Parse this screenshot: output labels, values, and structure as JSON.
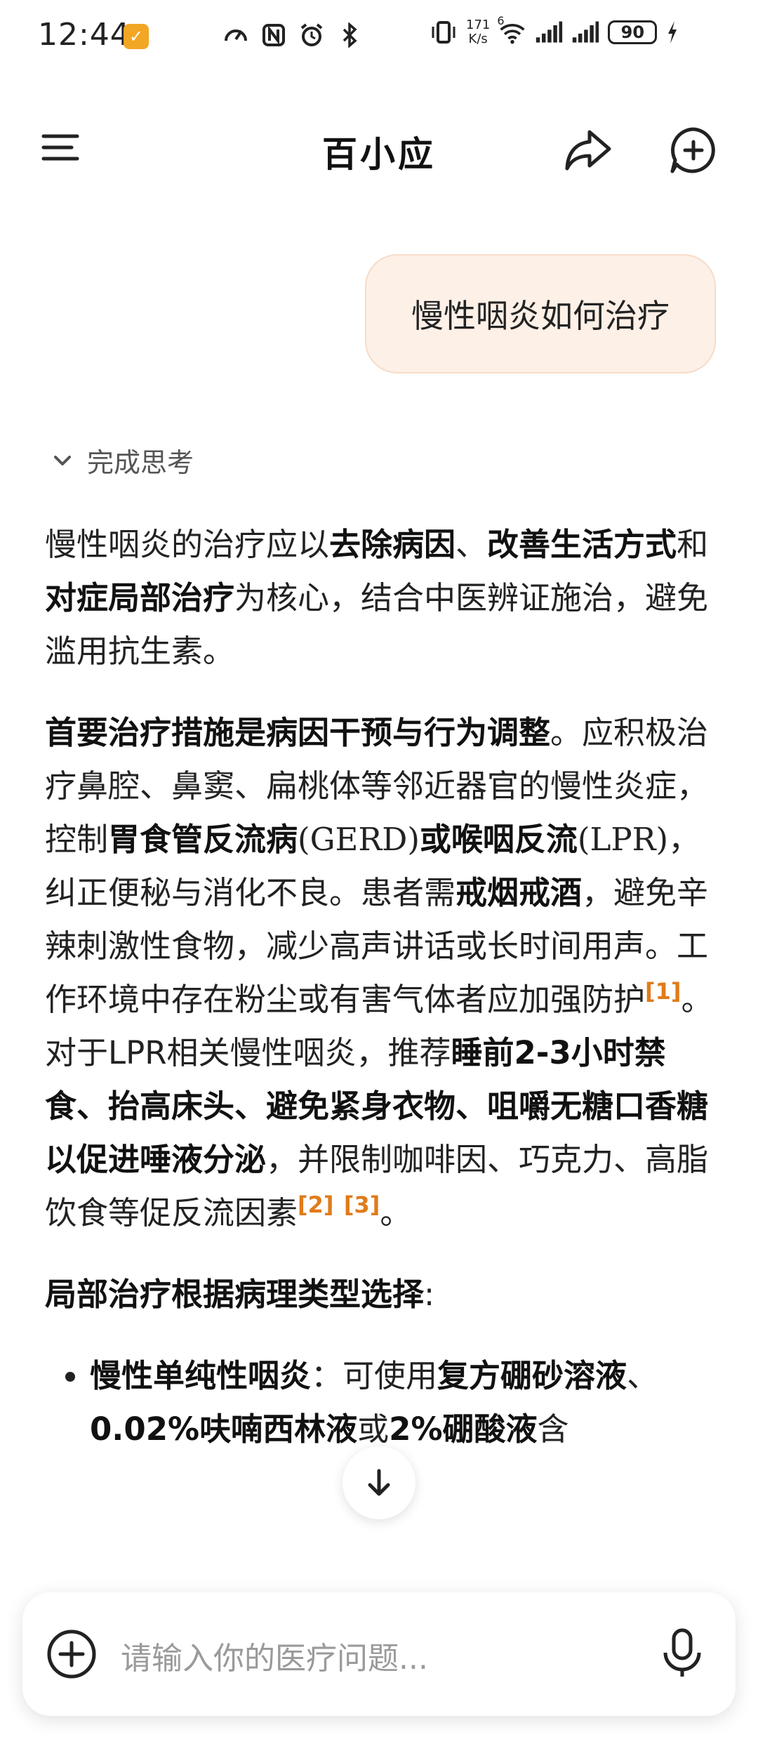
{
  "status_bar": {
    "time": "12:44",
    "net_speed_value": "171",
    "net_speed_unit": "K/s",
    "wifi_gen": "6",
    "battery": "90"
  },
  "header": {
    "title": "百小应",
    "icons": [
      "menu-icon",
      "share-icon",
      "new-chat-icon"
    ]
  },
  "chat": {
    "user_message": "慢性咽炎如何治疗",
    "thinking_label": "完成思考",
    "answer": {
      "p1": {
        "t1": "慢性咽炎的治疗应以",
        "b1": "去除病因",
        "t2": "、",
        "b2": "改善生活方式",
        "t3": "和",
        "b3": "对症局部治疗",
        "t4": "为核心，结合中医辨证施治，避免滥用抗生素。"
      },
      "p2": {
        "b1": "首要治疗措施是病因干预与行为调整",
        "t1": "。应积极治疗鼻腔、鼻窦、扁桃体等邻近器官的慢性炎症，控制",
        "b2": "胃食管反流病",
        "t2": "(GERD)",
        "b3": "或喉咽反流",
        "t3": "(LPR)",
        "t4": "，纠正便秘与消化不良。患者需",
        "b4": "戒烟戒酒",
        "t5": "，避免辛辣刺激性食物，减少高声讲话或长时间用声。工作环境中存在粉尘或有害气体者应加强防护",
        "ref1": "[1]",
        "t6": "。对于LPR相关慢性咽炎，推荐",
        "b5": "睡前2-3小时禁食、抬高床头、避免紧身衣物、咀嚼无糖口香糖以促进唾液分泌",
        "t7": "，并限制咖啡因、巧克力、高脂饮食等促反流因素",
        "ref2": "[2]",
        "ref3": "[3]",
        "t8": "。"
      },
      "p3": {
        "b1": "局部治疗根据病理类型选择",
        "t1": ":"
      },
      "bullet1": {
        "b1": "慢性单纯性咽炎",
        "t1": "：可使用",
        "b2": "复方硼砂溶液",
        "t2": "、",
        "b3": "0.02%呋喃西林液",
        "t3": "或",
        "b4": "2%硼酸液",
        "t4": "含"
      }
    }
  },
  "input": {
    "placeholder": "请输入你的医疗问题..."
  },
  "colors": {
    "accent_orange": "#e07b1a",
    "user_bubble_bg": "#fdf0e7"
  }
}
